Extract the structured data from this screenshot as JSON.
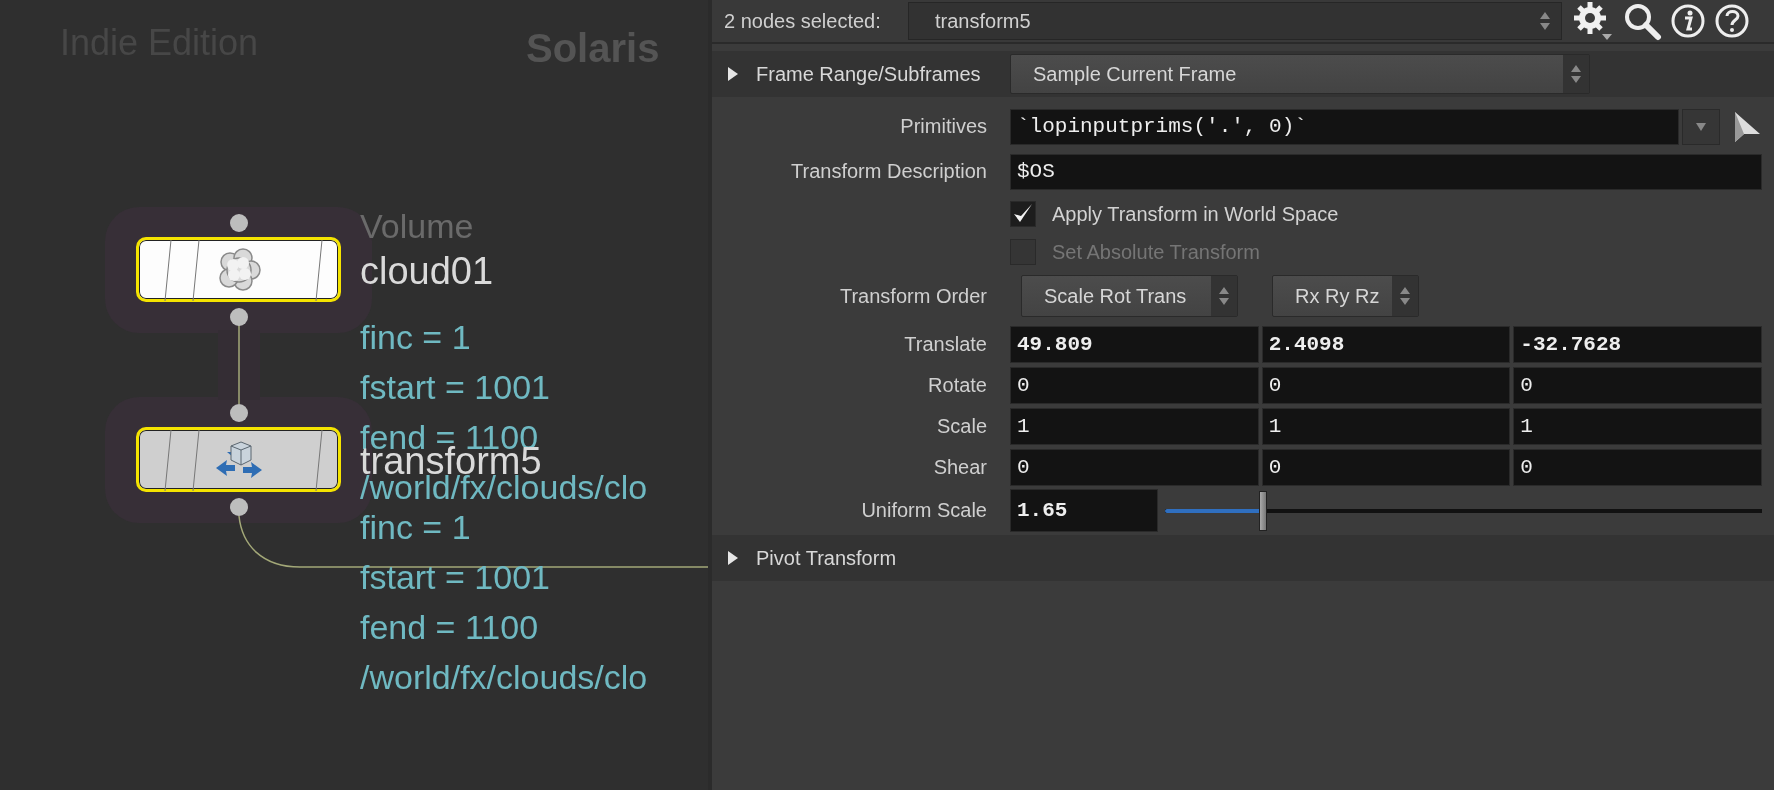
{
  "network": {
    "edition": "Indie Edition",
    "context": "Solaris",
    "nodes": [
      {
        "kind": "cloud",
        "type_label": "Volume",
        "name": "cloud01",
        "selected": true,
        "info": [
          "finc = 1",
          "fstart = 1001",
          "fend = 1100",
          "/world/fx/clouds/clo"
        ]
      },
      {
        "kind": "transform",
        "name": "transform5",
        "selected": true,
        "info": [
          "finc = 1",
          "fstart = 1001",
          "fend = 1100",
          "/world/fx/clouds/clo"
        ]
      }
    ]
  },
  "parameters": {
    "header": {
      "label": "2 nodes selected:",
      "node": "transform5"
    },
    "rows": [
      {
        "kind": "folder",
        "label": "Frame Range/Subframes",
        "expanded": false,
        "value": "Sample Current Frame"
      },
      {
        "kind": "string",
        "label": "Primitives",
        "value": "`lopinputprims('.', 0)`",
        "has_menu": true
      },
      {
        "kind": "string",
        "label": "Transform Description",
        "value": "$OS",
        "has_menu": false
      },
      {
        "kind": "toggle",
        "label": "Apply Transform in World Space",
        "checked": true,
        "disabled": false
      },
      {
        "kind": "toggle",
        "label": "Set Absolute Transform",
        "checked": false,
        "disabled": true
      },
      {
        "kind": "menus",
        "label": "Transform Order",
        "values": [
          "Scale Rot Trans",
          "Rx Ry Rz"
        ]
      },
      {
        "kind": "vector",
        "label": "Translate",
        "values": [
          "49.809",
          "2.4098",
          "-32.7628"
        ],
        "modified": true
      },
      {
        "kind": "vector",
        "label": "Rotate",
        "values": [
          "0",
          "0",
          "0"
        ],
        "modified": false
      },
      {
        "kind": "vector",
        "label": "Scale",
        "values": [
          "1",
          "1",
          "1"
        ],
        "modified": false
      },
      {
        "kind": "vector",
        "label": "Shear",
        "values": [
          "0",
          "0",
          "0"
        ],
        "modified": false
      },
      {
        "kind": "slider",
        "label": "Uniform Scale",
        "value": "1.65",
        "modified": true,
        "level": 0.164
      },
      {
        "kind": "folder",
        "label": "Pivot Transform",
        "expanded": false
      }
    ]
  }
}
